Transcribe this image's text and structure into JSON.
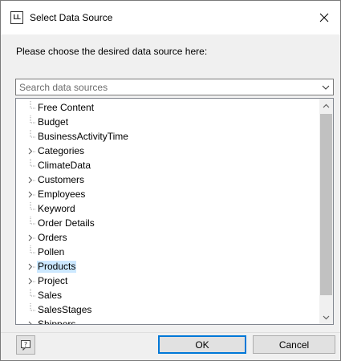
{
  "window": {
    "app_icon_text": "LL",
    "title": "Select Data Source"
  },
  "prompt": "Please choose the desired data source here:",
  "search": {
    "placeholder": "Search data sources",
    "value": ""
  },
  "tree": {
    "items": [
      {
        "label": "Free Content",
        "expandable": false,
        "selected": false
      },
      {
        "label": "Budget",
        "expandable": false,
        "selected": false
      },
      {
        "label": "BusinessActivityTime",
        "expandable": false,
        "selected": false
      },
      {
        "label": "Categories",
        "expandable": true,
        "selected": false
      },
      {
        "label": "ClimateData",
        "expandable": false,
        "selected": false
      },
      {
        "label": "Customers",
        "expandable": true,
        "selected": false
      },
      {
        "label": "Employees",
        "expandable": true,
        "selected": false
      },
      {
        "label": "Keyword",
        "expandable": false,
        "selected": false
      },
      {
        "label": "Order Details",
        "expandable": false,
        "selected": false
      },
      {
        "label": "Orders",
        "expandable": true,
        "selected": false
      },
      {
        "label": "Pollen",
        "expandable": false,
        "selected": false
      },
      {
        "label": "Products",
        "expandable": true,
        "selected": true
      },
      {
        "label": "Project",
        "expandable": true,
        "selected": false
      },
      {
        "label": "Sales",
        "expandable": false,
        "selected": false
      },
      {
        "label": "SalesStages",
        "expandable": false,
        "selected": false
      },
      {
        "label": "Shippers",
        "expandable": true,
        "selected": false
      }
    ]
  },
  "buttons": {
    "ok": "OK",
    "cancel": "Cancel"
  },
  "icons": {
    "close": "close-icon",
    "help": "help-icon",
    "chevron": "chevron-down-icon",
    "expand": "expand-chevron-icon"
  },
  "colors": {
    "selection": "#cce8ff",
    "default_button_border": "#0078d7"
  }
}
